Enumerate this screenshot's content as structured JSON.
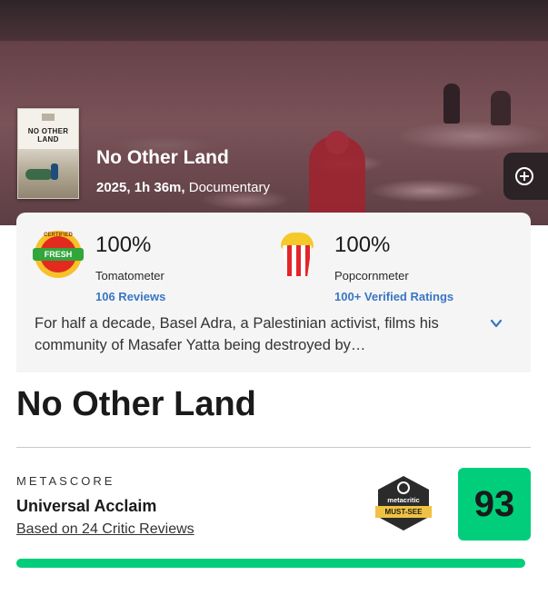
{
  "hero": {
    "poster_title": "NO OTHER LAND",
    "title": "No Other Land",
    "year_runtime": "2025, 1h 36m,",
    "genre": "Documentary"
  },
  "scores": {
    "tomatometer": {
      "badge_top": "CERTIFIED",
      "badge_label": "FRESH",
      "percent": "100%",
      "label": "Tomatometer",
      "reviews_link": "106 Reviews"
    },
    "popcornmeter": {
      "percent": "100%",
      "label": "Popcornmeter",
      "ratings_link": "100+ Verified Ratings"
    }
  },
  "synopsis": "For half a decade, Basel Adra, a Palestinian activist, films his community of Masafer Yatta being destroyed by…",
  "metacritic": {
    "title": "No Other Land",
    "label": "METASCORE",
    "acclaim": "Universal Acclaim",
    "reviews_link": "Based on 24 Critic Reviews",
    "badge_brand": "metacritic",
    "badge_label": "MUST-SEE",
    "score": "93",
    "score_fraction": 0.93,
    "score_color": "#00ce7a"
  },
  "icons": {
    "add": "plus-circle-icon",
    "expand": "chevron-down-icon",
    "tomatometer": "certified-fresh-icon",
    "popcornmeter": "popcorn-icon",
    "must_see": "metacritic-must-see-icon"
  }
}
